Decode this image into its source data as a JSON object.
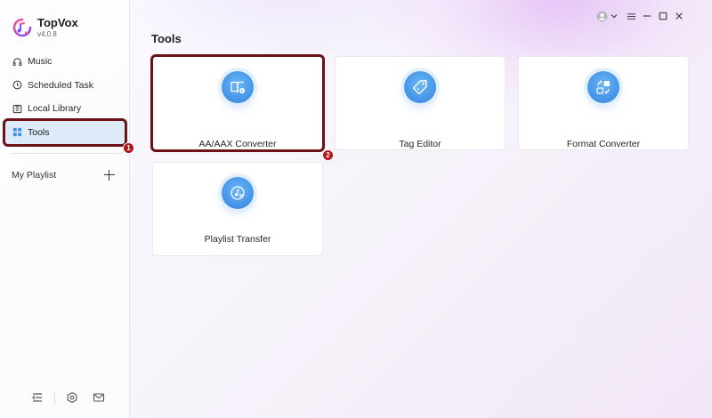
{
  "app": {
    "name": "TopVox",
    "version": "v4.0.8"
  },
  "sidebar": {
    "items": [
      {
        "label": "Music",
        "icon": "headphones-icon"
      },
      {
        "label": "Scheduled Task",
        "icon": "clock-icon"
      },
      {
        "label": "Local Library",
        "icon": "folder-icon"
      },
      {
        "label": "Tools",
        "icon": "grid-icon",
        "active": true
      }
    ],
    "playlist_label": "My Playlist",
    "badge_tools": "1"
  },
  "main": {
    "title": "Tools",
    "badge_converter": "2",
    "cards": [
      {
        "label": "AA/AAX Converter",
        "icon": "book-convert-icon"
      },
      {
        "label": "Tag Editor",
        "icon": "tag-icon"
      },
      {
        "label": "Format Converter",
        "icon": "shapes-convert-icon"
      },
      {
        "label": "Playlist Transfer",
        "icon": "disc-transfer-icon"
      }
    ]
  },
  "colors": {
    "accent": "#3f8fe6",
    "active_bg": "#ddeaf8",
    "highlight_border": "#6a1216",
    "badge": "#b3141a"
  }
}
